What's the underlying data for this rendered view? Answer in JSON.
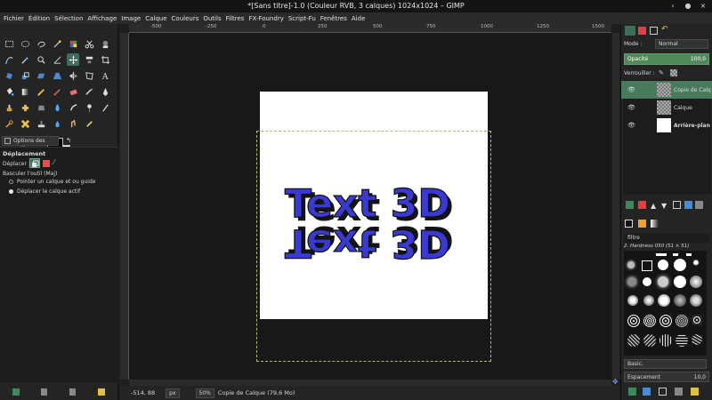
{
  "window": {
    "title": "*[Sans titre]-1.0 (Couleur RVB, 3 calques) 1024x1024 – GIMP",
    "buttons": [
      "‹",
      "●",
      "×"
    ]
  },
  "menu": [
    "Fichier",
    "Édition",
    "Sélection",
    "Affichage",
    "Image",
    "Calque",
    "Couleurs",
    "Outils",
    "Filtres",
    "FX-Foundry",
    "Script-Fu",
    "Fenêtres",
    "Aide"
  ],
  "tool_options": {
    "tab_label": "Options des outils",
    "tool_name": "Déplacement",
    "move_label": "Déplacer :",
    "toggle_label": "Basculer l'outil (Maj)",
    "radio_options": [
      "Pointer un calque et ou guide",
      "Déplacer le calque actif"
    ],
    "radio_selected": 1
  },
  "colors": {
    "accent": "#3c6f5a",
    "selected_layer": "#4a7a5c",
    "opacity_bar": "#4f8b5a",
    "canvas_text_front": "#3a3ad0",
    "canvas_text_shadow": "#141414",
    "foreground": "#000000",
    "background": "#ffffff"
  },
  "canvas": {
    "text": "Text 3D",
    "ruler_labels": [
      "-500",
      "-250",
      "0",
      "250",
      "500",
      "750",
      "1000",
      "1250",
      "1500"
    ]
  },
  "status": {
    "coords": "-514, 88",
    "unit": "px",
    "zoom": "50%",
    "message": "Copie de Calque (79,6 Mo)"
  },
  "layers_panel": {
    "mode_label": "Mode :",
    "mode_value": "Normal",
    "opacity_label": "Opacité",
    "opacity_value": "100,0",
    "lock_label": "Verrouiller :",
    "layers": [
      {
        "name": "Copie de Calq",
        "selected": true,
        "thumb": "checker"
      },
      {
        "name": "Calque",
        "selected": false,
        "thumb": "checker"
      },
      {
        "name": "Arrière-plan",
        "selected": false,
        "thumb": "white"
      }
    ]
  },
  "brushes_panel": {
    "filter_label": "filtre",
    "brush_name": "2. Hardness 050 (51 × 51)",
    "preset_value": "Basic,",
    "spacing_label": "Espacement",
    "spacing_value": "10,0"
  }
}
